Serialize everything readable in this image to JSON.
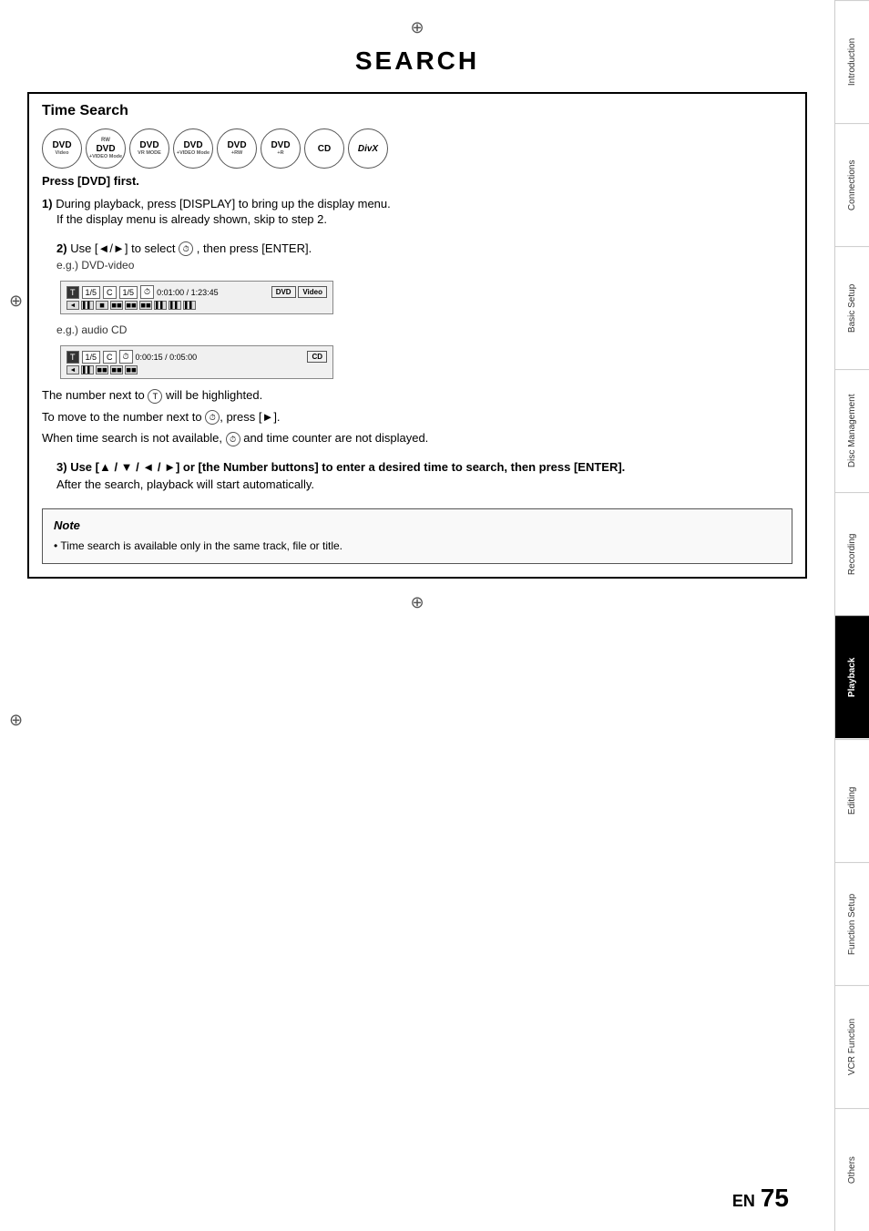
{
  "page": {
    "title": "SEARCH",
    "page_number": "75",
    "page_label": "EN"
  },
  "section": {
    "title": "Time Search"
  },
  "disc_badges": [
    {
      "top": "",
      "main": "DVD",
      "sub": "Video"
    },
    {
      "top": "RW",
      "main": "DVD",
      "sub": "+VIDEO Mode"
    },
    {
      "top": "",
      "main": "DVD",
      "sub": "VR MODE"
    },
    {
      "top": "",
      "main": "DVD",
      "sub": "+VIDEO Mode"
    },
    {
      "top": "",
      "main": "DVD",
      "sub": "+RW"
    },
    {
      "top": "",
      "main": "DVD",
      "sub": "+R"
    },
    {
      "top": "",
      "main": "CD",
      "sub": ""
    },
    {
      "top": "",
      "main": "DivX",
      "sub": ""
    }
  ],
  "press_note": "Press [DVD] first.",
  "steps": [
    {
      "num": "1)",
      "text": "During playback, press [DISPLAY] to bring up the display menu.",
      "sub": "If the display menu is already shown, skip to step 2."
    },
    {
      "num": "2)",
      "text": "Use [◄/►] to select",
      "text2": ", then press [ENTER].",
      "eg1_label": "e.g.) DVD-video",
      "eg1_row1_left": "T  1/ 5  C  1/ 5  ●  0:01:00 / 1:23:45",
      "eg1_row2": "◄ ▌▌ ◼◼ ◼◼ ◼◼ ◼◼  ▌▌ ▌▌ ▌▌",
      "eg1_badge": "DVD Video",
      "eg2_label": "e.g.) audio CD",
      "eg2_row1": "T  1/ 5  C  ●  0:00:15 / 0:05:00",
      "eg2_row2": "◄ ◼◼ ◼◼◼◼ ◼◼",
      "eg2_badge": "CD"
    },
    {
      "highlight_text1": "The number next to",
      "highlight_icon": "T",
      "highlight_text2": "will be highlighted.",
      "move_text1": "To move to the number next to",
      "move_icon": "●",
      "move_text2": ", press [►].",
      "when_text": "When time search is not available,",
      "when_icon": "●",
      "when_text2": "and time counter are not displayed."
    },
    {
      "num": "3)",
      "text": "Use [▲ / ▼ / ◄ / ►] or [the Number buttons] to enter a desired time to search, then press [ENTER].",
      "sub": "After the search, playback will start automatically."
    }
  ],
  "note": {
    "title": "Note",
    "bullet": "•",
    "text": "Time search is available only in the same track, file or title."
  },
  "sidebar_tabs": [
    {
      "label": "Introduction",
      "active": false
    },
    {
      "label": "Connections",
      "active": false
    },
    {
      "label": "Basic Setup",
      "active": false
    },
    {
      "label": "Disc Management",
      "active": false
    },
    {
      "label": "Recording",
      "active": false
    },
    {
      "label": "Playback",
      "active": true
    },
    {
      "label": "Editing",
      "active": false
    },
    {
      "label": "Function Setup",
      "active": false
    },
    {
      "label": "VCR Function",
      "active": false
    },
    {
      "label": "Others",
      "active": false
    }
  ]
}
